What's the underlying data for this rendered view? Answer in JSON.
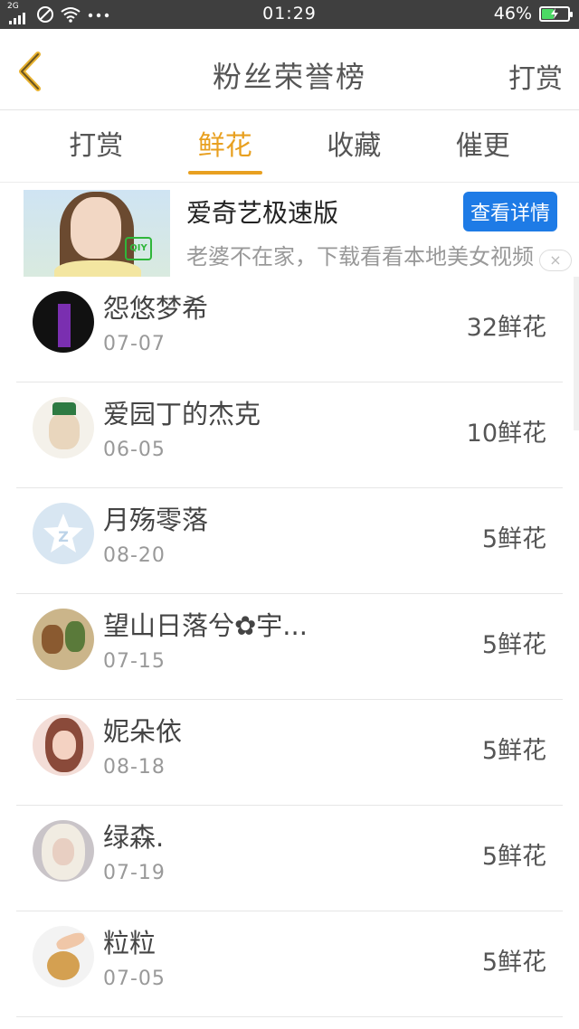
{
  "status_bar": {
    "network": "2G",
    "time": "01:29",
    "battery_percent": "46%",
    "battery_level": 0.46,
    "icons": [
      "signal-icon",
      "no-disturb-icon",
      "wifi-icon",
      "more-dots-icon",
      "battery-charging-icon"
    ]
  },
  "header": {
    "title": "粉丝荣誉榜",
    "right_action": "打赏",
    "back_icon": "chevron-left-icon",
    "accent_color": "#e8a020"
  },
  "tabs": [
    {
      "label": "打赏",
      "active": false
    },
    {
      "label": "鲜花",
      "active": true
    },
    {
      "label": "收藏",
      "active": false
    },
    {
      "label": "催更",
      "active": false
    }
  ],
  "ad": {
    "title": "爱奇艺极速版",
    "description": "老婆不在家，下载看看本地美女视频",
    "button_label": "查看详情",
    "button_color": "#1e7be6",
    "thumb_logo": "QIY",
    "close_glyph": "×"
  },
  "fans": [
    {
      "name": "怨悠梦希",
      "date": "07-07",
      "flowers": "32鲜花"
    },
    {
      "name": "爱园丁的杰克",
      "date": "06-05",
      "flowers": "10鲜花"
    },
    {
      "name": "月殇零落",
      "date": "08-20",
      "flowers": "5鲜花"
    },
    {
      "name": "望山日落兮✿宇...",
      "date": "07-15",
      "flowers": "5鲜花"
    },
    {
      "name": "妮朵依",
      "date": "08-18",
      "flowers": "5鲜花"
    },
    {
      "name": "绿森.",
      "date": "07-19",
      "flowers": "5鲜花"
    },
    {
      "name": "粒粒",
      "date": "07-05",
      "flowers": "5鲜花"
    }
  ]
}
